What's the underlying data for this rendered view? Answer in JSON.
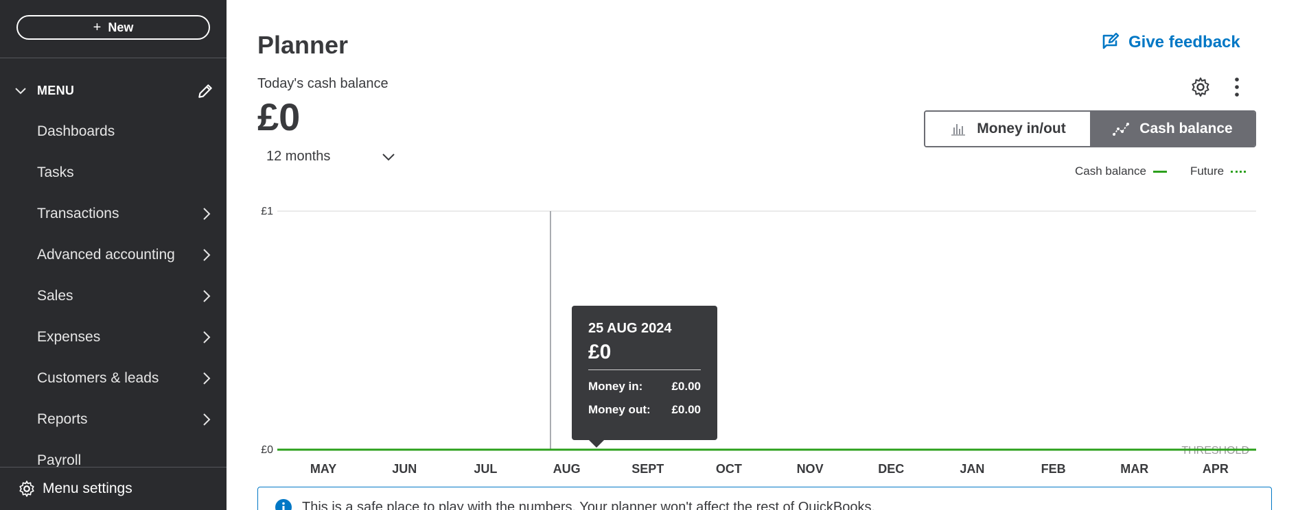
{
  "sidebar": {
    "new_label": "New",
    "menu_label": "MENU",
    "items": [
      {
        "label": "Dashboards",
        "has_children": false
      },
      {
        "label": "Tasks",
        "has_children": false
      },
      {
        "label": "Transactions",
        "has_children": true
      },
      {
        "label": "Advanced accounting",
        "has_children": true
      },
      {
        "label": "Sales",
        "has_children": true
      },
      {
        "label": "Expenses",
        "has_children": true
      },
      {
        "label": "Customers & leads",
        "has_children": true
      },
      {
        "label": "Reports",
        "has_children": true
      },
      {
        "label": "Payroll",
        "has_children": false
      }
    ],
    "menu_settings_label": "Menu settings"
  },
  "header": {
    "title": "Planner",
    "feedback_label": "Give feedback"
  },
  "cash": {
    "label": "Today's cash balance",
    "value": "£0",
    "period": "12 months"
  },
  "view_toggle": {
    "money_label": "Money in/out",
    "cash_label": "Cash balance",
    "selected": "cash"
  },
  "legend": {
    "cash_balance": "Cash balance",
    "future": "Future"
  },
  "chart_data": {
    "type": "line",
    "categories": [
      "MAY",
      "JUN",
      "JUL",
      "AUG",
      "SEPT",
      "OCT",
      "NOV",
      "DEC",
      "JAN",
      "FEB",
      "MAR",
      "APR"
    ],
    "series": [
      {
        "name": "Cash balance",
        "values": [
          0,
          0,
          0,
          0,
          0,
          0,
          0,
          0,
          0,
          0,
          0,
          0
        ]
      }
    ],
    "yticks": [
      "£1",
      "£0"
    ],
    "ylim": [
      0,
      1
    ],
    "threshold_label": "THRESHOLD",
    "colors": {
      "line": "#2ca01c",
      "grid": "#e3e3e3",
      "threshold": "#9a9a9a"
    }
  },
  "tooltip": {
    "date": "25 AUG 2024",
    "value": "£0",
    "money_in_label": "Money in:",
    "money_in_value": "£0.00",
    "money_out_label": "Money out:",
    "money_out_value": "£0.00"
  },
  "banner": {
    "text": "This is a safe place to play with the numbers. Your planner won't affect the rest of QuickBooks."
  },
  "colors": {
    "sidebar_bg": "#2a2b2e",
    "accent_blue": "#0077c5",
    "accent_green": "#2ca01c",
    "toggle_active": "#6b6c72"
  }
}
